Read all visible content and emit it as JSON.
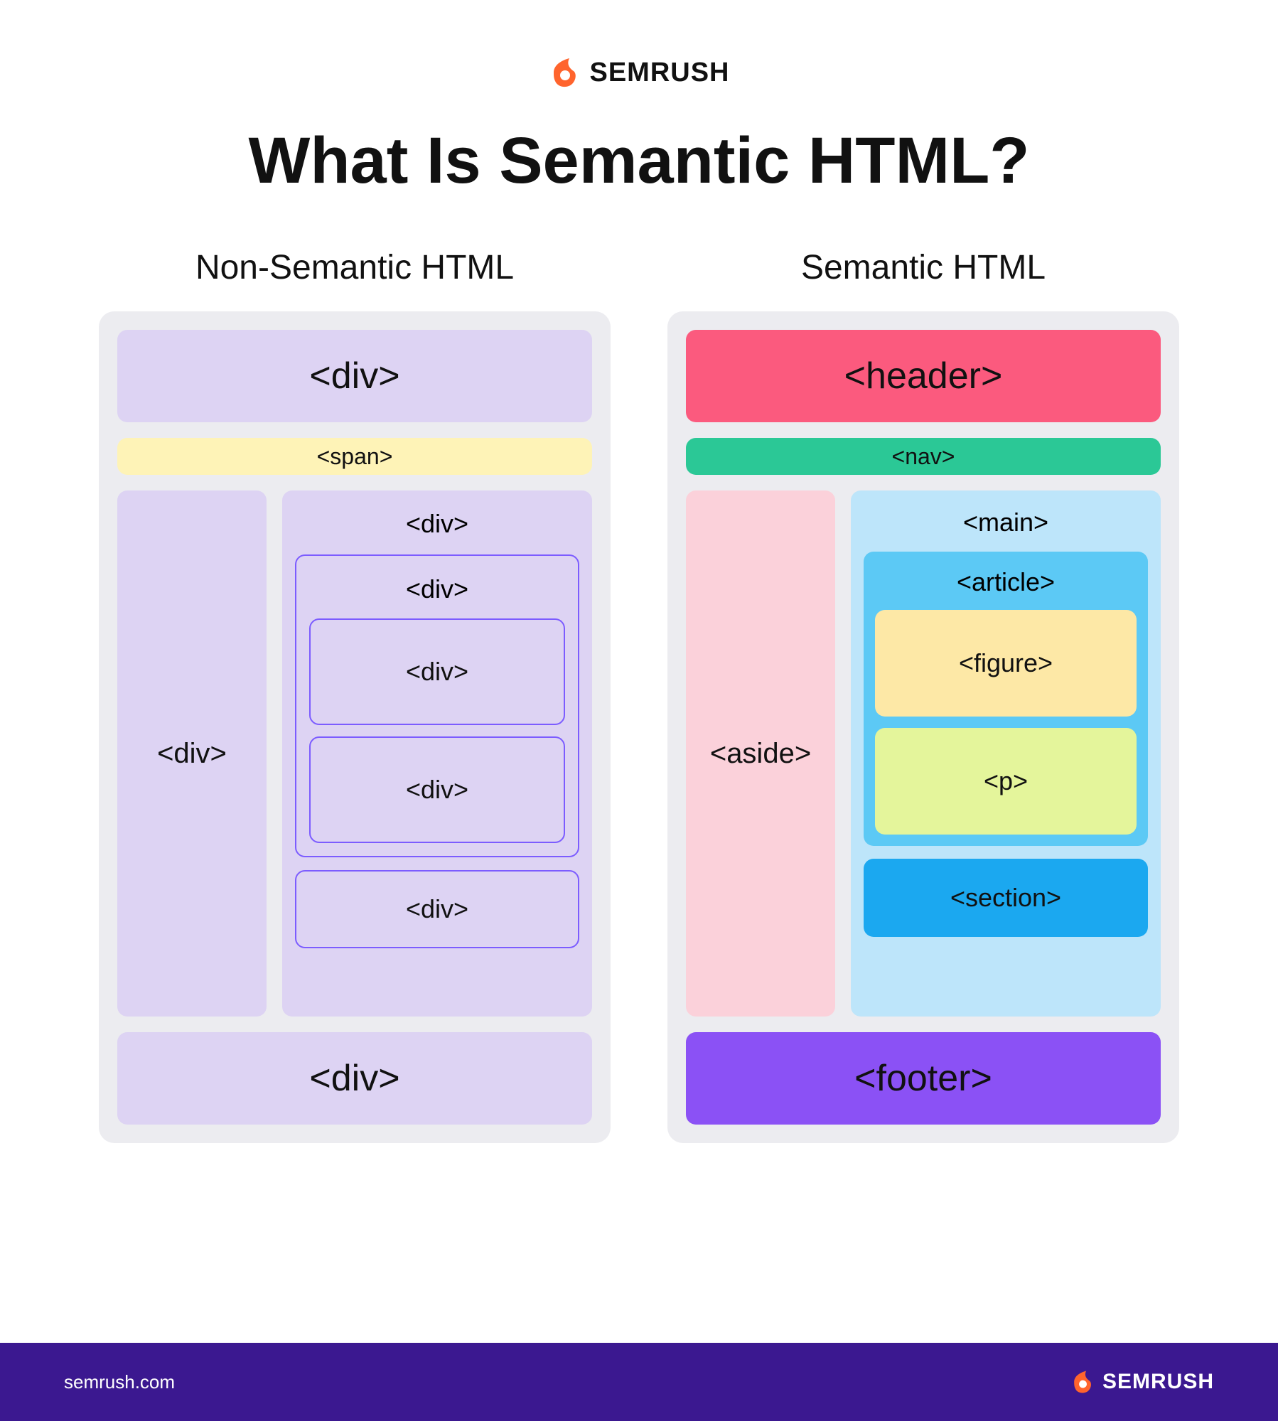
{
  "brand": {
    "name": "SEMRUSH"
  },
  "title": "What Is Semantic HTML?",
  "columns": {
    "left": {
      "title": "Non-Semantic HTML",
      "header": "<div>",
      "nav": "<span>",
      "aside": "<div>",
      "main": "<div>",
      "article": "<div>",
      "figure": "<div>",
      "p": "<div>",
      "section": "<div>",
      "footer": "<div>"
    },
    "right": {
      "title": "Semantic HTML",
      "header": "<header>",
      "nav": "<nav>",
      "aside": "<aside>",
      "main": "<main>",
      "article": "<article>",
      "figure": "<figure>",
      "p": "<p>",
      "section": "<section>",
      "footer": "<footer>"
    }
  },
  "footer": {
    "url": "semrush.com",
    "brand": "SEMRUSH"
  },
  "colors": {
    "brand_orange": "#ff642d",
    "footer_bg": "#3b1890",
    "lavender": "#ddd3f3",
    "yellow": "#fef3b7",
    "outline_purple": "#7c5cff",
    "pink": "#fb5a7e",
    "green": "#2bc896",
    "rose": "#fbd1da",
    "sky_light": "#bde5fa",
    "sky": "#5cc9f5",
    "cream": "#fde8a6",
    "lime": "#e4f59b",
    "blue_bright": "#1ba8f0",
    "violet": "#8b51f5"
  }
}
